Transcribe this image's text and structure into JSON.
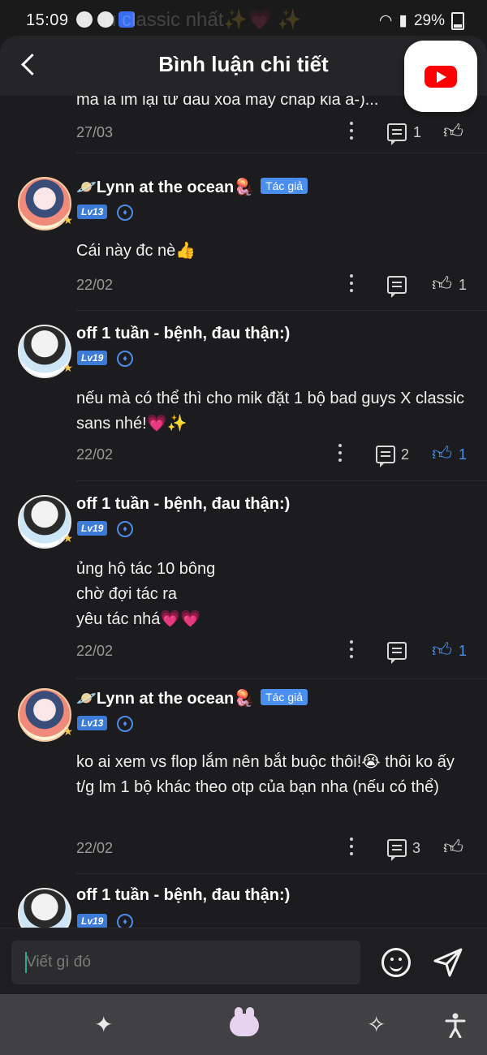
{
  "status_bar": {
    "time": "15:09",
    "overlay_text": "u classic nhất✨💗 ✨",
    "battery": "29%"
  },
  "header": {
    "title": "Bình luận chi tiết"
  },
  "comments": [
    {
      "name": "",
      "tag": "",
      "level": "",
      "text": "mà là lm lại từ đầu xóa mấy chap kia á-)...",
      "date": "27/03",
      "replies": "1",
      "likes": "",
      "liked": false
    },
    {
      "name": "🪐Lynn at the ocean🪼",
      "tag": "Tác giả",
      "level": "Lv13",
      "text": "Cái này đc nè👍",
      "date": "22/02",
      "replies": "",
      "likes": "1",
      "liked": false
    },
    {
      "name": "off 1 tuần - bệnh, đau thận:)",
      "tag": "",
      "level": "Lv19",
      "text": "nếu mà có thể thì cho mik đặt 1 bộ bad guys X classic sans nhé!💗✨",
      "date": "22/02",
      "replies": "2",
      "likes": "1",
      "liked": true
    },
    {
      "name": "off 1 tuần - bệnh, đau thận:)",
      "tag": "",
      "level": "Lv19",
      "text": "ủng hộ tác 10 bông\nchờ đợi tác ra\nyêu tác nhá💗💗",
      "date": "22/02",
      "replies": "",
      "likes": "1",
      "liked": true
    },
    {
      "name": "🪐Lynn at the ocean🪼",
      "tag": "Tác giả",
      "level": "Lv13",
      "text": "ko ai xem vs flop lắm nên bắt buộc thôi!😭 thôi ko ấy t/g lm 1 bộ khác theo otp của bạn nha (nếu có thể)",
      "date": "22/02",
      "replies": "3",
      "likes": "",
      "liked": false
    },
    {
      "name": "off 1 tuần - bệnh, đau thận:)",
      "tag": "",
      "level": "Lv19",
      "text": "",
      "date": "",
      "replies": "",
      "likes": "",
      "liked": false
    }
  ],
  "input": {
    "placeholder": "Viết gì đó"
  },
  "icons": {
    "back": "chevron-left-icon",
    "youtube": "youtube-icon",
    "more": "more-vertical-icon",
    "reply": "comment-icon",
    "like": "thumbs-up-icon",
    "emoji": "smiley-icon",
    "send": "send-icon",
    "nav": [
      "sparkles-icon",
      "bunny-icon",
      "ai-sparkle-icon",
      "accessibility-icon"
    ]
  },
  "colors": {
    "background": "#1c1c1e",
    "accent": "#4a90f0",
    "tag": "#4a8ef0",
    "text": "#f0f0f0",
    "muted": "#9a9a9a"
  }
}
